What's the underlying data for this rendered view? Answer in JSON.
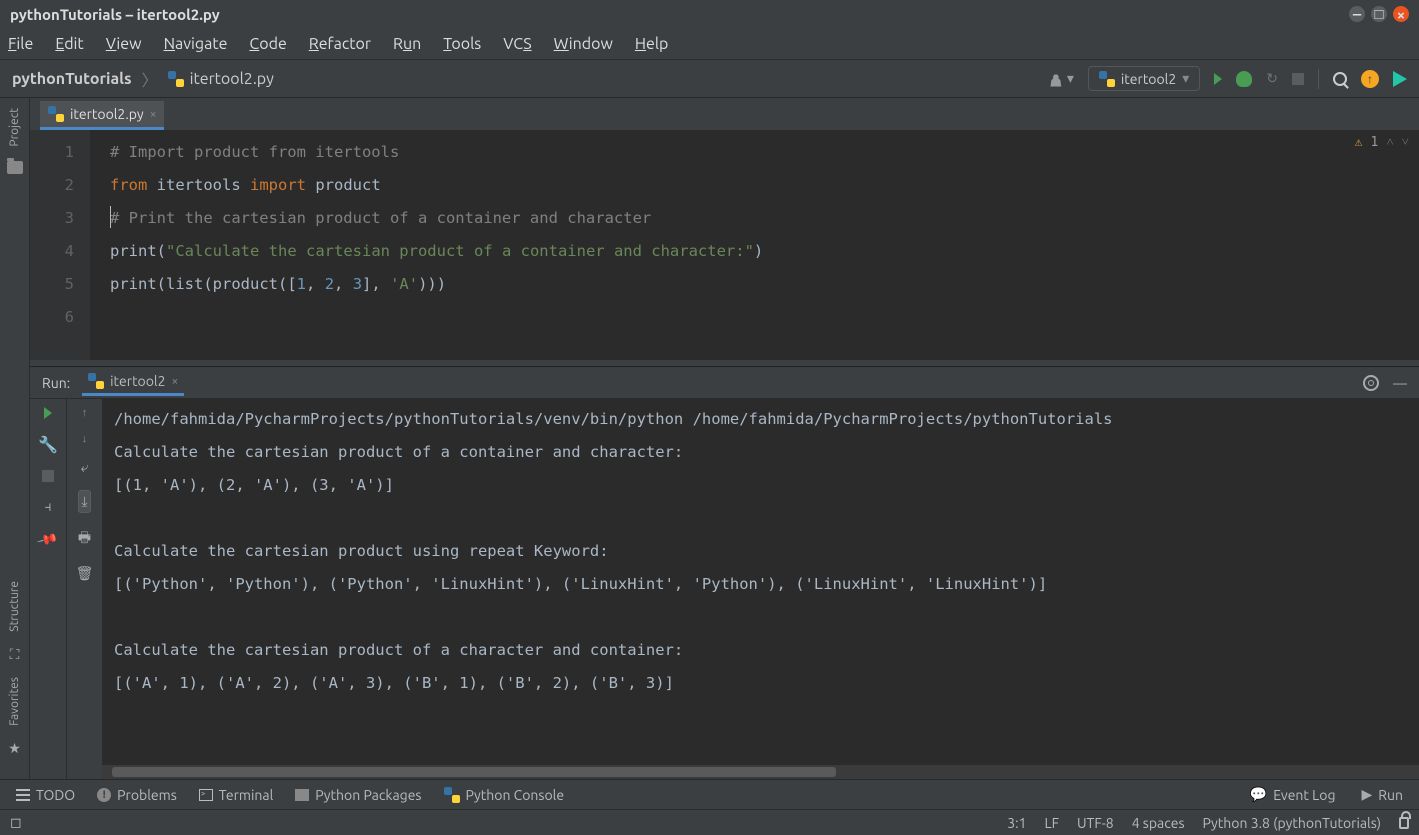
{
  "titlebar": {
    "text": "pythonTutorials – itertool2.py"
  },
  "menu": {
    "file": "File",
    "edit": "Edit",
    "view": "View",
    "navigate": "Navigate",
    "code": "Code",
    "refactor": "Refactor",
    "run": "Run",
    "tools": "Tools",
    "vcs": "VCS",
    "window": "Window",
    "help": "Help"
  },
  "breadcrumb": {
    "project": "pythonTutorials",
    "file": "itertool2.py"
  },
  "runConfig": {
    "name": "itertool2"
  },
  "leftTools": {
    "project": "Project",
    "structure": "Structure",
    "favorites": "Favorites"
  },
  "editorTab": {
    "name": "itertool2.py"
  },
  "editor": {
    "warnCount": "1",
    "lines": [
      {
        "n": "1",
        "segs": [
          {
            "t": "# Import product from itertools",
            "c": "cmt"
          }
        ]
      },
      {
        "n": "2",
        "segs": [
          {
            "t": "from ",
            "c": "kw"
          },
          {
            "t": "itertools ",
            "c": "fn"
          },
          {
            "t": "import ",
            "c": "kw"
          },
          {
            "t": "product",
            "c": "fn"
          }
        ]
      },
      {
        "n": "3",
        "segs": [
          {
            "t": "",
            "c": "fn"
          }
        ]
      },
      {
        "n": "4",
        "segs": [
          {
            "t": "# Print the cartesian product of a container and character",
            "c": "cmt"
          }
        ]
      },
      {
        "n": "5",
        "segs": [
          {
            "t": "print",
            "c": "fn"
          },
          {
            "t": "(",
            "c": "fn"
          },
          {
            "t": "\"Calculate the cartesian product of a container and character:\"",
            "c": "str"
          },
          {
            "t": ")",
            "c": "fn"
          }
        ]
      },
      {
        "n": "6",
        "segs": [
          {
            "t": "print",
            "c": "fn"
          },
          {
            "t": "(",
            "c": "fn"
          },
          {
            "t": "list",
            "c": "fn"
          },
          {
            "t": "(product([",
            "c": "fn"
          },
          {
            "t": "1",
            "c": "num"
          },
          {
            "t": ", ",
            "c": "fn"
          },
          {
            "t": "2",
            "c": "num"
          },
          {
            "t": ", ",
            "c": "fn"
          },
          {
            "t": "3",
            "c": "num"
          },
          {
            "t": "]",
            "c": "fn"
          },
          {
            "t": ", ",
            "c": "fn"
          },
          {
            "t": "'A'",
            "c": "str"
          },
          {
            "t": ")))",
            "c": "fn"
          }
        ]
      }
    ]
  },
  "runPanel": {
    "title": "Run:",
    "tab": "itertool2",
    "output": [
      "/home/fahmida/PycharmProjects/pythonTutorials/venv/bin/python /home/fahmida/PycharmProjects/pythonTutorials",
      "Calculate the cartesian product of a container and character:",
      "[(1, 'A'), (2, 'A'), (3, 'A')]",
      "",
      "Calculate the cartesian product using repeat Keyword:",
      "[('Python', 'Python'), ('Python', 'LinuxHint'), ('LinuxHint', 'Python'), ('LinuxHint', 'LinuxHint')]",
      "",
      "Calculate the cartesian product of a character and container:",
      "[('A', 1), ('A', 2), ('A', 3), ('B', 1), ('B', 2), ('B', 3)]"
    ]
  },
  "bottomTools": {
    "todo": "TODO",
    "problems": "Problems",
    "terminal": "Terminal",
    "pkgs": "Python Packages",
    "console": "Python Console",
    "eventlog": "Event Log",
    "run": "Run"
  },
  "status": {
    "pos": "3:1",
    "lineEnding": "LF",
    "encoding": "UTF-8",
    "indent": "4 spaces",
    "interpreter": "Python 3.8 (pythonTutorials)"
  }
}
